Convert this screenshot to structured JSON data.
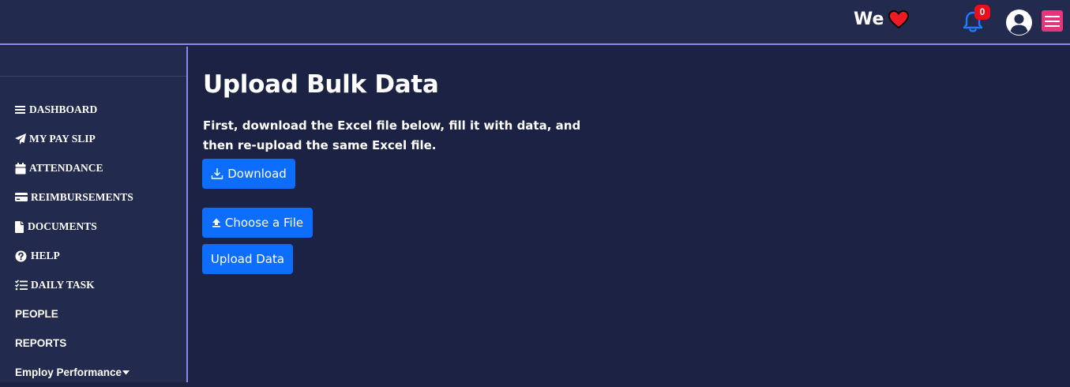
{
  "header": {
    "brand_text": "We",
    "notification_count": "0",
    "accent_color": "#e5357c",
    "icons": [
      "heart-icon",
      "bell-icon",
      "user-circle-icon",
      "hamburger-icon"
    ]
  },
  "sidebar": {
    "items": [
      {
        "label": "DASHBOARD",
        "icon": "bars-icon"
      },
      {
        "label": "MY PAY SLIP",
        "icon": "paper-plane-icon"
      },
      {
        "label": "ATTENDANCE",
        "icon": "calendar-icon"
      },
      {
        "label": "REIMBURSEMENTS",
        "icon": "credit-card-icon"
      },
      {
        "label": "DOCUMENTS",
        "icon": "file-icon"
      },
      {
        "label": "HELP",
        "icon": "question-circle-icon"
      },
      {
        "label": "DAILY TASK",
        "icon": "task-list-icon"
      },
      {
        "label": "PEOPLE",
        "icon": ""
      },
      {
        "label": "REPORTS",
        "icon": ""
      },
      {
        "label": "Employ Performance",
        "icon": "caret-down-icon"
      }
    ]
  },
  "main": {
    "title": "Upload Bulk Data",
    "instruction": "First, download the Excel file below, fill it with data, and then re-upload the same Excel file.",
    "download_label": "Download",
    "choose_file_label": "Choose a File",
    "upload_label": "Upload Data",
    "button_color": "#0d6efd"
  }
}
